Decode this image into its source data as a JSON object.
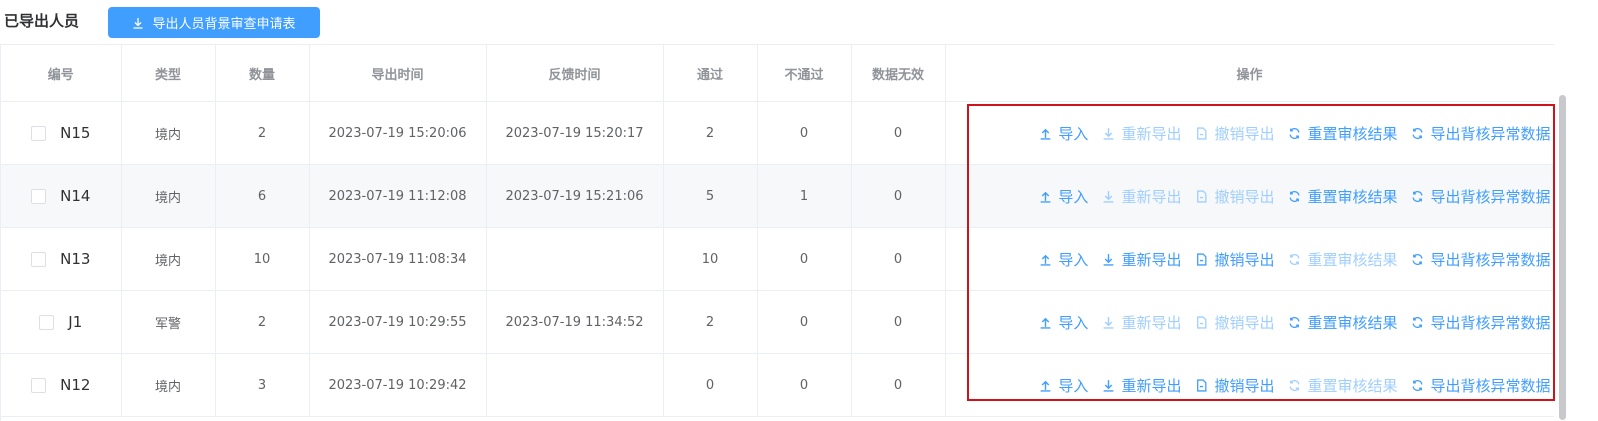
{
  "section": {
    "title": "已导出人员",
    "export_button_label": "导出人员背景审查申请表"
  },
  "table": {
    "headers": [
      "编号",
      "类型",
      "数量",
      "导出时间",
      "反馈时间",
      "通过",
      "不通过",
      "数据无效",
      "操作"
    ],
    "rows": [
      {
        "code": "N15",
        "type": "境内",
        "count": "2",
        "export_time": "2023-07-19 15:20:06",
        "feedback_time": "2023-07-19 15:20:17",
        "pass": "2",
        "fail": "0",
        "invalid": "0"
      },
      {
        "code": "N14",
        "type": "境内",
        "count": "6",
        "export_time": "2023-07-19 11:12:08",
        "feedback_time": "2023-07-19 15:21:06",
        "pass": "5",
        "fail": "1",
        "invalid": "0"
      },
      {
        "code": "N13",
        "type": "境内",
        "count": "10",
        "export_time": "2023-07-19 11:08:34",
        "feedback_time": "",
        "pass": "10",
        "fail": "0",
        "invalid": "0"
      },
      {
        "code": "J1",
        "type": "军警",
        "count": "2",
        "export_time": "2023-07-19 10:29:55",
        "feedback_time": "2023-07-19 11:34:52",
        "pass": "2",
        "fail": "0",
        "invalid": "0"
      },
      {
        "code": "N12",
        "type": "境内",
        "count": "3",
        "export_time": "2023-07-19 10:29:42",
        "feedback_time": "",
        "pass": "0",
        "fail": "0",
        "invalid": "0"
      }
    ],
    "actions": {
      "import": "导入",
      "reexport": "重新导出",
      "revoke": "撤销导出",
      "reset": "重置审核结果",
      "export_abnormal": "导出背核异常数据"
    }
  },
  "colors": {
    "primary": "#409eff",
    "disabled": "#a0cfff",
    "highlight_border": "#d0121b"
  }
}
